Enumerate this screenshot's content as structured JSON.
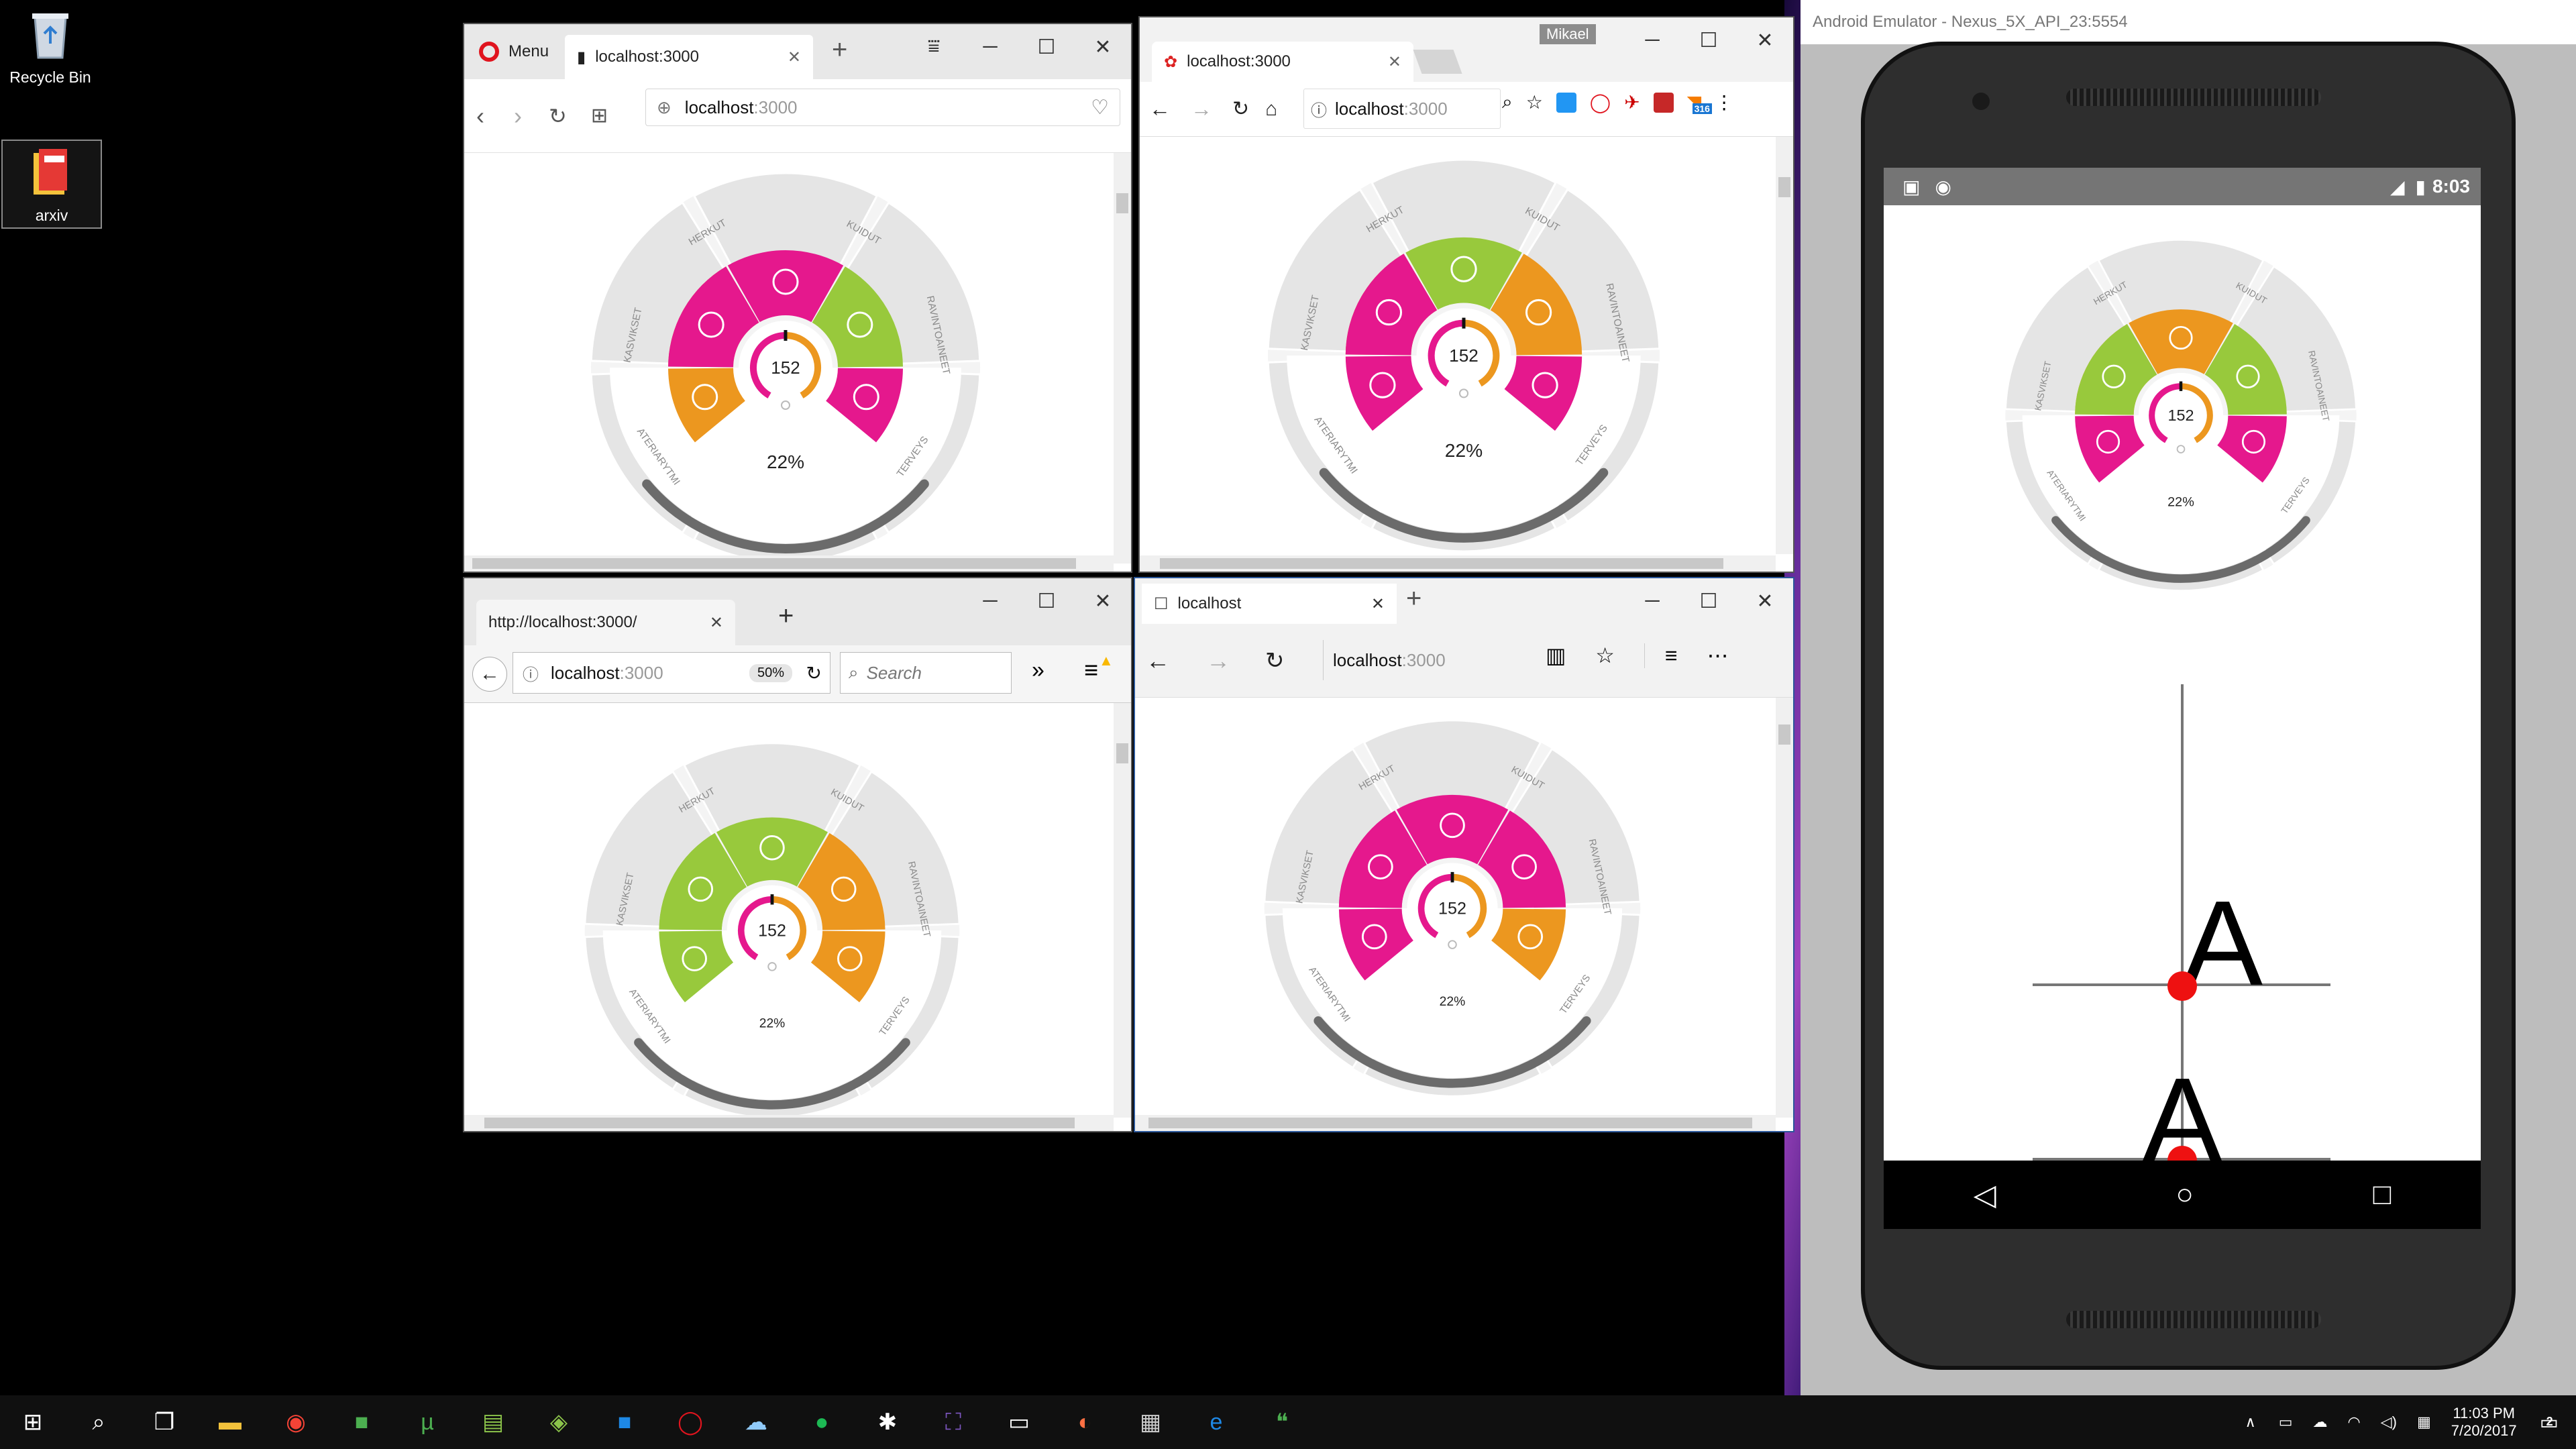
{
  "desktop": {
    "recycle_bin": "Recycle Bin",
    "folder": "arxiv"
  },
  "wheel": {
    "value": "152",
    "percent": "22%",
    "segments": [
      "HERKUT",
      "KUIDUT",
      "RAVINTOAINEET",
      "TERVEYS",
      "ATERIARYTMI",
      "KASVIKSET"
    ]
  },
  "colors": {
    "orange": "#ec971f",
    "pink": "#e5188d",
    "green": "#98c93c",
    "grey": "#e5e5e5",
    "ring": "#6b6b6b"
  },
  "opera": {
    "menu": "Menu",
    "tab": "localhost:3000",
    "address_host": "localhost",
    "address_port": ":3000"
  },
  "chrome": {
    "user": "Mikael",
    "tab": "localhost:3000",
    "address_host": "localhost",
    "address_port": ":3000",
    "badge": "316"
  },
  "firefox": {
    "tab": "http://localhost:3000/",
    "address_host": "localhost",
    "address_port": ":3000",
    "zoom": "50%",
    "search_placeholder": "Search"
  },
  "edge": {
    "tab": "localhost",
    "address_host": "localhost",
    "address_port": ":3000"
  },
  "emulator": {
    "title": "Android Emulator - Nexus_5X_API_23:5554",
    "clock": "8:03",
    "glyph": "A"
  },
  "taskbar": {
    "time": "11:03 PM",
    "date": "7/20/2017",
    "notifications": "2"
  }
}
